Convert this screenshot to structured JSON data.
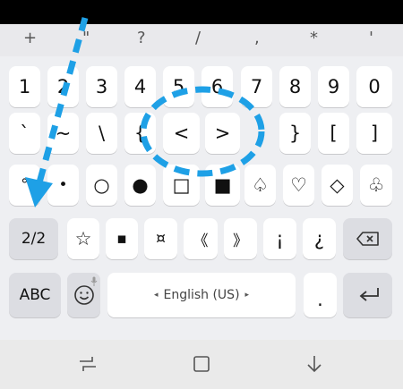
{
  "suggestions": [
    "+",
    "\"",
    "?",
    "/",
    ",",
    "*",
    "'"
  ],
  "rows": [
    [
      "1",
      "2",
      "3",
      "4",
      "5",
      "6",
      "7",
      "8",
      "9",
      "0"
    ],
    [
      "`",
      "~",
      "\\",
      "{",
      "<",
      ">",
      "}",
      "[",
      "]"
    ],
    [
      "°",
      "•",
      "○",
      "●",
      "□",
      "■",
      "♤",
      "♡",
      "◇",
      "♧"
    ],
    [
      "☆",
      "▪",
      "¤",
      "《",
      "》",
      "¡",
      "¿"
    ]
  ],
  "page_key": "2/2",
  "abc_key": "ABC",
  "period_key": ".",
  "space": {
    "left_arrow": "◂",
    "label": "English (US)",
    "right_arrow": "▸"
  },
  "colors": {
    "annotation": "#1ea0e6",
    "keyboard_bg": "#eeeff2",
    "key_bg": "#ffffff"
  },
  "icons": {
    "backspace": "backspace-icon",
    "emoji": "emoji-icon",
    "mic": "mic-icon",
    "enter": "enter-icon",
    "recents": "recent-apps-icon",
    "home": "home-icon",
    "back": "back-icon"
  }
}
